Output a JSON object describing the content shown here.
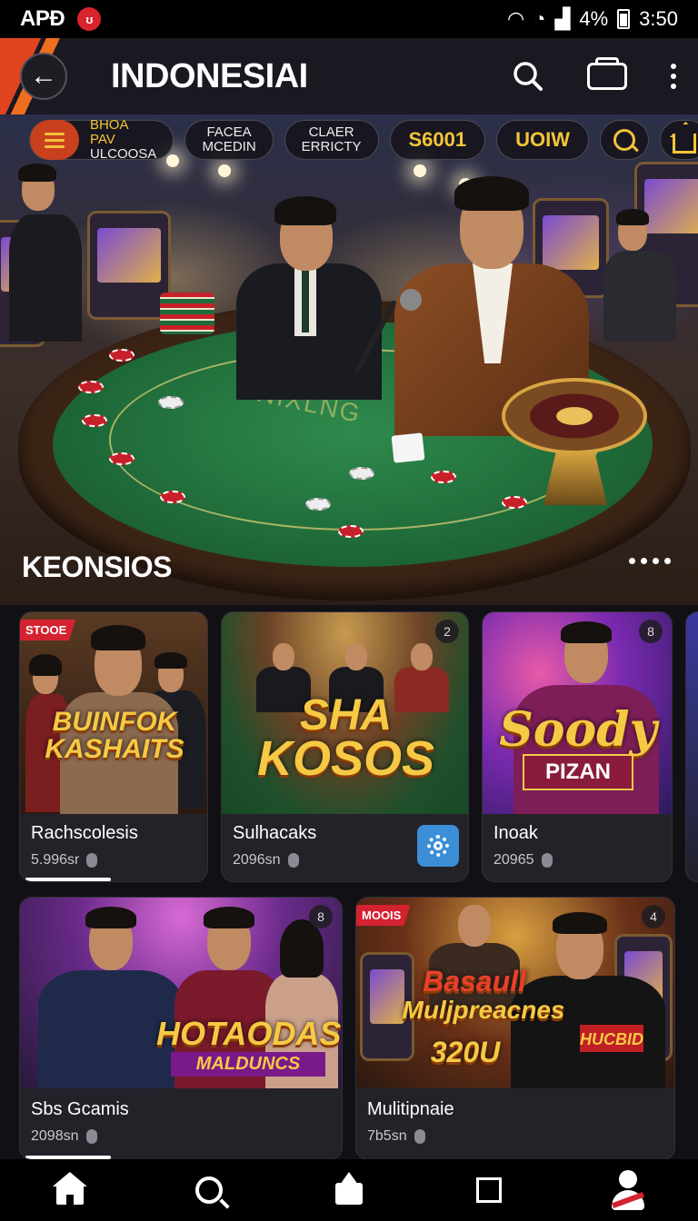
{
  "status_bar": {
    "carrier": "APÐ",
    "notif_icon": "notification-badge",
    "battery": "4%",
    "time": "3:50"
  },
  "app_bar": {
    "title": "INDONESIAI",
    "back_icon": "arrow-left-icon",
    "search_icon": "search-icon",
    "cart_icon": "cart-icon",
    "more_icon": "more-vertical-icon",
    "accent": "#e0451f"
  },
  "filters": {
    "menu_line1": "BHOA PAV",
    "menu_line2": "ULCOOSA",
    "chip1_line1": "FACEA",
    "chip1_line2": "MCEDIN",
    "chip2_line1": "CLAER",
    "chip2_line2": "ERRICTY",
    "chip3": "S6001",
    "chip4": "UOIW"
  },
  "hero": {
    "felt_text": "DNIXLNG"
  },
  "section": {
    "title": "KEONSIOS"
  },
  "cards": [
    {
      "tag": "STOOE",
      "logo": "BUINFOK KASHAITS",
      "title": "Rachscolesis",
      "meta": "5.996sr"
    },
    {
      "badge": "2",
      "logo_top": "SHA",
      "logo_bottom": "KOSOS",
      "title": "Sulhacaks",
      "meta": "2096sn"
    },
    {
      "badge": "8",
      "logo_top": "Soody",
      "logo_bottom": "PIZAN",
      "title": "Inoak",
      "meta": "20965"
    },
    {
      "badge": "8",
      "logo_top": "HOTAODAS",
      "logo_bottom": "MALDUNCS",
      "title": "Sbs Gcamis",
      "meta": "2098sn"
    },
    {
      "tag": "MOOIS",
      "badge": "4",
      "logo_top": "Basaull",
      "logo_mid": "Muljpreacnes",
      "logo_bottom": "320U",
      "jersey": "HUCBID",
      "title": "Mulitipnaie",
      "meta": "7b5sn"
    }
  ],
  "bottom_nav": [
    "home-icon",
    "search-icon",
    "bag-icon",
    "square-icon",
    "profile-icon"
  ],
  "colors": {
    "gold": "#f4c438",
    "felt": "#1f6a39",
    "tag_red": "#d52230",
    "gear_blue": "#3c8fd6"
  }
}
